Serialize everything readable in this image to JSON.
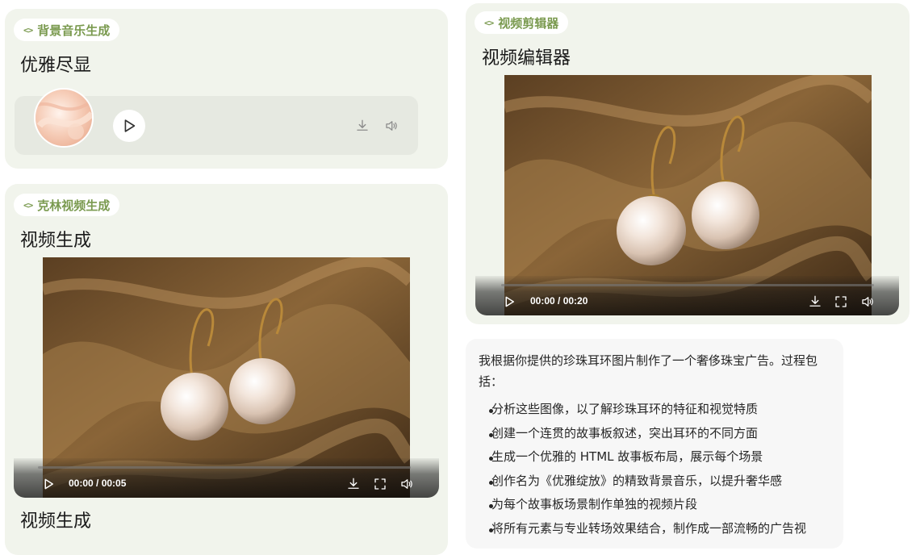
{
  "bg_music_card": {
    "tag_label": "背景音乐生成",
    "title": "优雅尽显"
  },
  "video_gen_card": {
    "tag_label": "克林视频生成",
    "title": "视频生成",
    "time": "00:00 / 00:05",
    "next_title": "视频生成"
  },
  "editor_card": {
    "tag_label": "视频剪辑器",
    "title": "视频编辑器",
    "time": "00:00 / 00:20"
  },
  "message": {
    "intro": "我根据你提供的珍珠耳环图片制作了一个奢侈珠宝广告。过程包括：",
    "steps": [
      "分析这些图像，以了解珍珠耳环的特征和视觉特质",
      "创建一个连贯的故事板叙述，突出耳环的不同方面",
      "生成一个优雅的 HTML 故事板布局，展示每个场景",
      "创作名为《优雅绽放》的精致背景音乐，以提升奢华感",
      "为每个故事板场景制作单独的视频片段",
      "将所有元素与专业转场效果结合，制作成一部流畅的广告视"
    ]
  },
  "colors": {
    "card_bg": "#f1f4ec",
    "accent": "#7a9a4f",
    "player_bg": "#e6e9e1"
  },
  "icons": [
    "code-icon",
    "play-icon",
    "download-icon",
    "volume-icon",
    "fullscreen-icon"
  ]
}
